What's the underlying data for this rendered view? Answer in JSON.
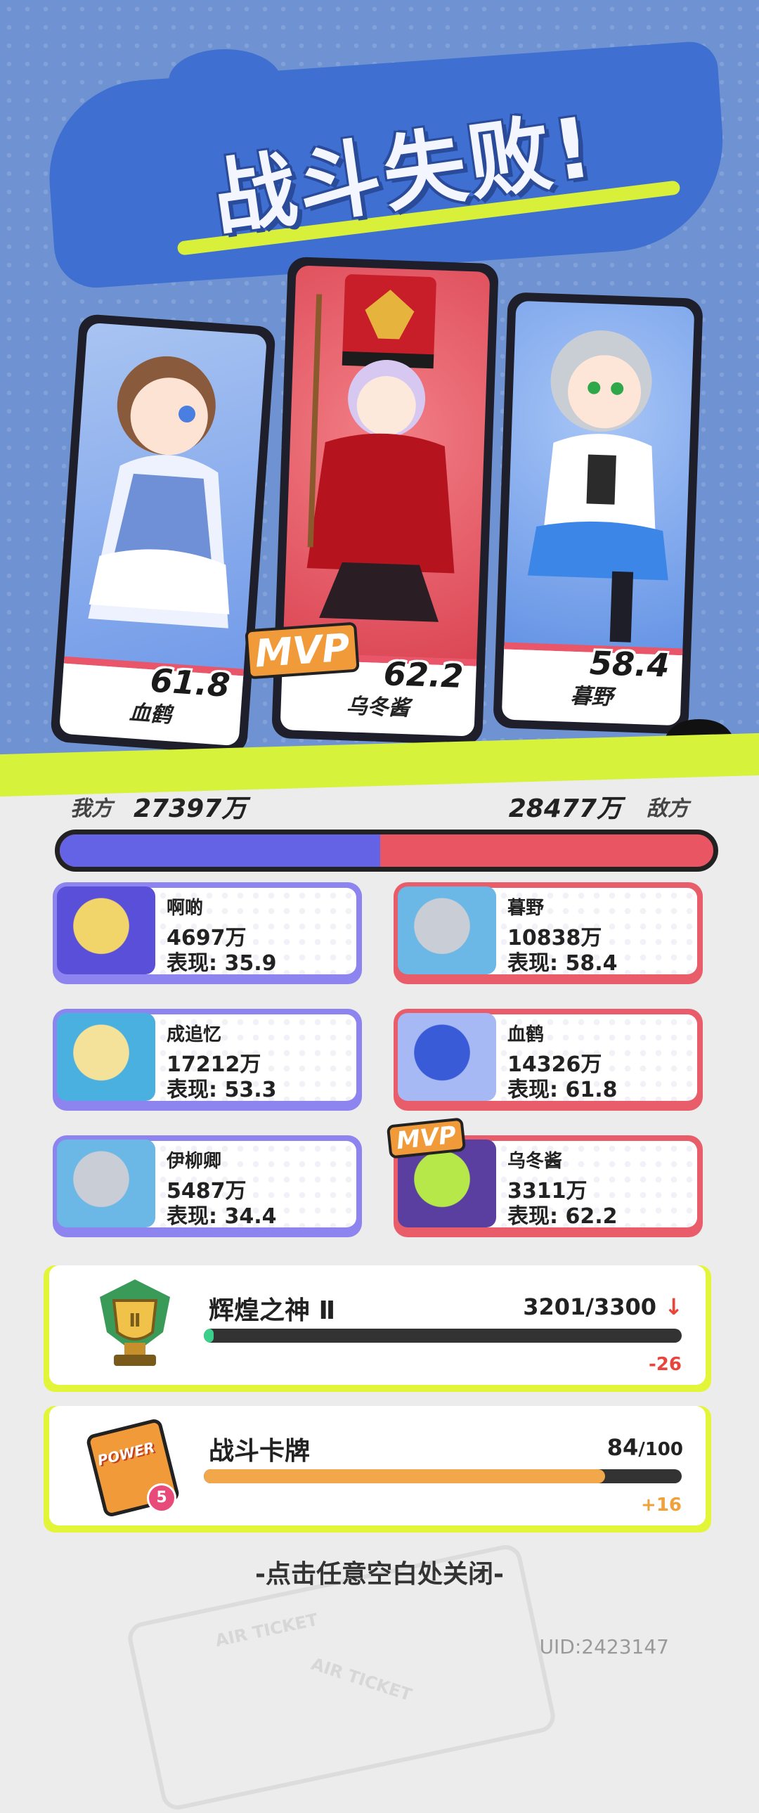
{
  "header": {
    "title": "战斗失败!"
  },
  "heroes": [
    {
      "name": "血鹤",
      "score": "61.8"
    },
    {
      "name": "乌冬酱",
      "score": "62.2",
      "mvp": "MVP"
    },
    {
      "name": "暮野",
      "score": "58.4"
    }
  ],
  "teams": {
    "my_label": "我方",
    "my_total": "27397万",
    "enemy_label": "敌方",
    "enemy_total": "28477万",
    "my_share": 0.49
  },
  "players_left": [
    {
      "name": "啊啲",
      "damage": "4697万",
      "perf": "表现: 35.9"
    },
    {
      "name": "成追忆",
      "damage": "17212万",
      "perf": "表现: 53.3"
    },
    {
      "name": "伊柳卿",
      "damage": "5487万",
      "perf": "表现: 34.4"
    }
  ],
  "players_right": [
    {
      "name": "暮野",
      "damage": "10838万",
      "perf": "表现: 58.4"
    },
    {
      "name": "血鹤",
      "damage": "14326万",
      "perf": "表现: 61.8"
    },
    {
      "name": "乌冬酱",
      "damage": "3311万",
      "perf": "表现: 62.2",
      "mvp": "MVP"
    }
  ],
  "rank": {
    "title": "辉煌之神 Ⅱ",
    "value": "3201/3300",
    "delta": "-26",
    "progress": 0.02,
    "badge": "Ⅱ"
  },
  "cards": {
    "title": "战斗卡牌",
    "value_current": "84",
    "value_max": "/100",
    "delta": "+16",
    "progress": 0.84,
    "icon_text": "POWER",
    "badge": "5"
  },
  "footer": {
    "close_hint": "-点击任意空白处关闭-",
    "uid": "UID:2423147",
    "ticket_text_1": "AIR TICKET",
    "ticket_text_2": "AIR TICKET"
  },
  "colors": {
    "blue_team": "#6463e6",
    "red_team": "#ea5563",
    "accent": "#d6f23b",
    "down": "#e8453c",
    "up": "#f0a13c"
  }
}
